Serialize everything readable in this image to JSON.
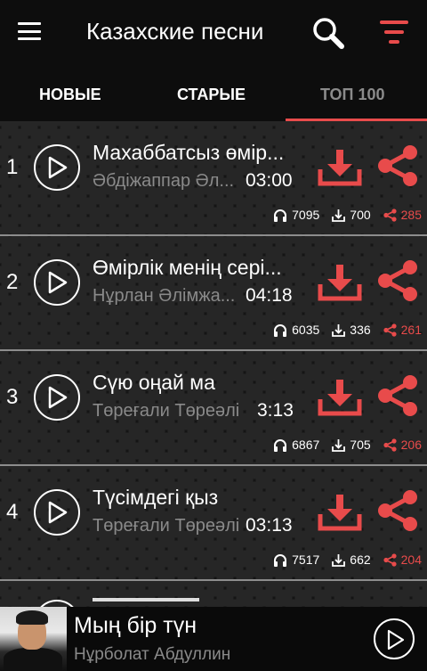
{
  "header": {
    "title": "Казахские песни"
  },
  "tabs": [
    {
      "label": "НОВЫЕ",
      "active": false
    },
    {
      "label": "СТАРЫЕ",
      "active": false
    },
    {
      "label": "ТОП 100",
      "active": true
    }
  ],
  "accent_color": "#e84b4b",
  "songs": [
    {
      "rank": "1",
      "title": "Махаббатсыз өмір...",
      "artist": "Әбдіжаппар Әл...",
      "duration": "03:00",
      "plays": "7095",
      "downloads": "700",
      "shares": "285"
    },
    {
      "rank": "2",
      "title": "Өмірлік менің сері...",
      "artist": "Нұрлан Әлімжа...",
      "duration": "04:18",
      "plays": "6035",
      "downloads": "336",
      "shares": "261"
    },
    {
      "rank": "3",
      "title": "Сүю оңай ма",
      "artist": "Төреғали Төреәлі",
      "duration": "3:13",
      "plays": "6867",
      "downloads": "705",
      "shares": "206"
    },
    {
      "rank": "4",
      "title": "Түсімдегі қыз",
      "artist": "Төреғали Төреәлі",
      "duration": "03:13",
      "plays": "7517",
      "downloads": "662",
      "shares": "204"
    }
  ],
  "player": {
    "title": "Мың бір түн",
    "artist": "Нұрболат Абдуллин"
  }
}
